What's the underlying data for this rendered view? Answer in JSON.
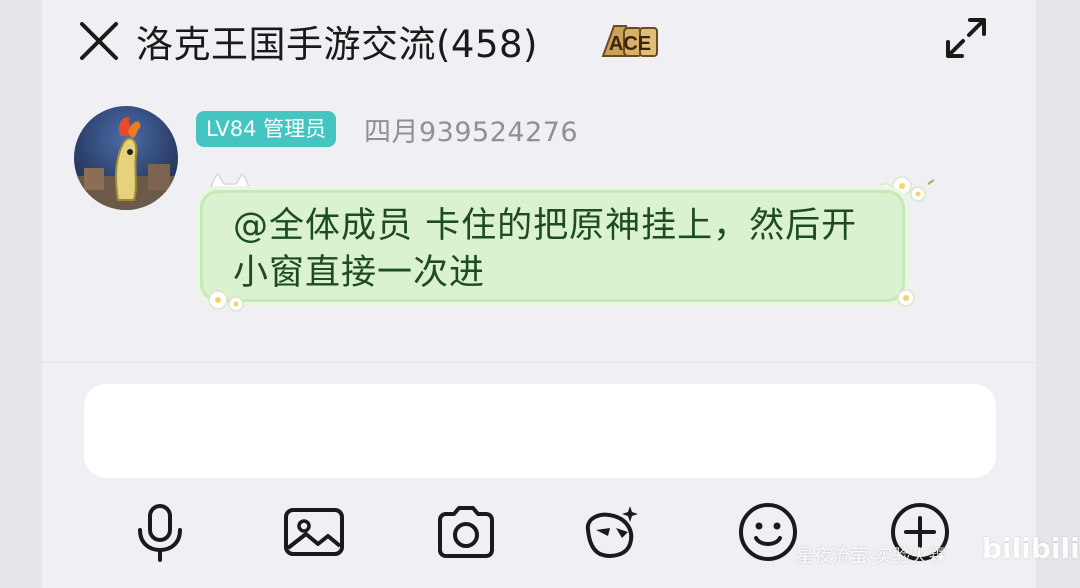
{
  "header": {
    "title": "洛克王国手游交流(458)",
    "ace_badge_text": "ACE",
    "icons": {
      "close": "close-icon",
      "expand": "expand-icon"
    }
  },
  "message": {
    "badge": "LV84 管理员",
    "nickname": "四月939524276",
    "text": "@全体成员 卡住的把原神挂上，然后开小窗直接一次进"
  },
  "input": {
    "value": ""
  },
  "toolbar": {
    "icons": [
      "microphone-icon",
      "image-icon",
      "camera-icon",
      "sticker-icon",
      "emoji-icon",
      "plus-icon"
    ]
  },
  "watermark": {
    "text": "星夜流萤-实验火霖",
    "site": "bilibili"
  },
  "colors": {
    "badge": "#45c5c2",
    "bubble": "#daf2cf",
    "bubble_text": "#1d4b22",
    "nickname": "#8f8f95"
  }
}
